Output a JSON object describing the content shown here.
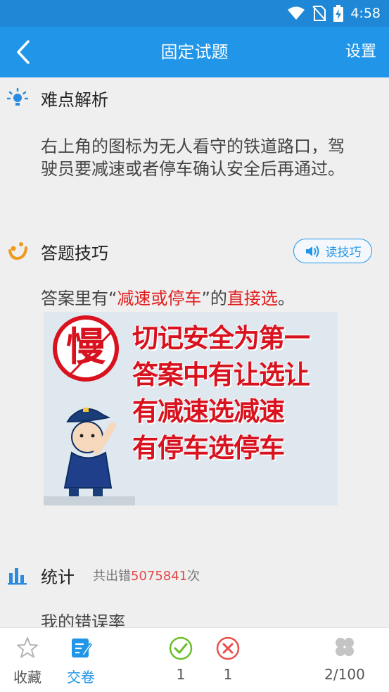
{
  "status_bar": {
    "time": "4:58"
  },
  "app_bar": {
    "title": "固定试题",
    "settings_label": "设置"
  },
  "analysis": {
    "title": "难点解析",
    "text": "右上角的图标为无人看守的铁道路口，驾驶员要减速或者停车确认安全后再通过。"
  },
  "tips": {
    "title": "答题技巧",
    "read_button_label": "读技巧",
    "text_prefix": "答案里有",
    "text_quote_open": "“",
    "text_keyword": "减速或停车",
    "text_quote_close": "”",
    "text_middle": "的",
    "text_action": "直接选",
    "text_end": "。",
    "poster": {
      "stamp_char": "慢",
      "lines": [
        "切记安全为第一",
        "答案中有让选让",
        "有减速选减速",
        "有停车选停车"
      ]
    }
  },
  "stats": {
    "title": "统计",
    "count_prefix": "共出错",
    "count_value": "5075841",
    "count_suffix": "次",
    "error_rate_label": "我的错误率"
  },
  "bottom_bar": {
    "favorite_label": "收藏",
    "submit_label": "交卷",
    "correct_count": "1",
    "wrong_count": "1",
    "progress": "2/100"
  },
  "colors": {
    "app_bar": "#2196e8",
    "status_bar": "#1e88d6",
    "accent_red": "#e21e1e",
    "correct_green": "#6cbe2a",
    "wrong_red": "#e8504a"
  }
}
